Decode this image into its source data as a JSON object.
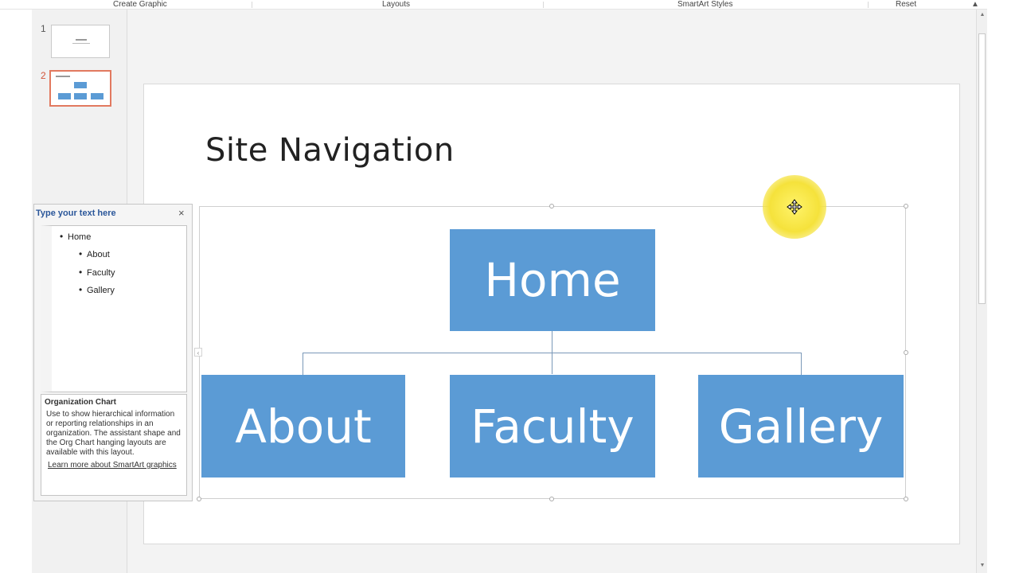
{
  "ribbon": {
    "groups": [
      "Create Graphic",
      "Layouts",
      "SmartArt Styles",
      "Reset"
    ],
    "collapse_icon": "caret-up-icon"
  },
  "thumbnails": [
    {
      "number": "1"
    },
    {
      "number": "2"
    }
  ],
  "slide": {
    "title": "Site Navigation"
  },
  "smartart": {
    "top": "Home",
    "children": [
      "About",
      "Faculty",
      "Gallery"
    ],
    "box_color": "#5b9bd5",
    "connector_color": "#7a98b8"
  },
  "text_pane": {
    "title": "Type your text here",
    "close": "×",
    "items": [
      {
        "text": "Home",
        "level": 1
      },
      {
        "text": "About",
        "level": 2
      },
      {
        "text": "Faculty",
        "level": 2
      },
      {
        "text": "Gallery",
        "level": 2
      }
    ],
    "desc_title": "Organization Chart",
    "desc_text": "Use to show hierarchical information or reporting relationships in an organization. The assistant shape and the Org Chart hanging layouts are available with this layout.",
    "link": "Learn more about SmartArt graphics"
  },
  "cursor": {
    "icon": "move-cursor-icon",
    "highlight_color": "#f5e23b"
  }
}
